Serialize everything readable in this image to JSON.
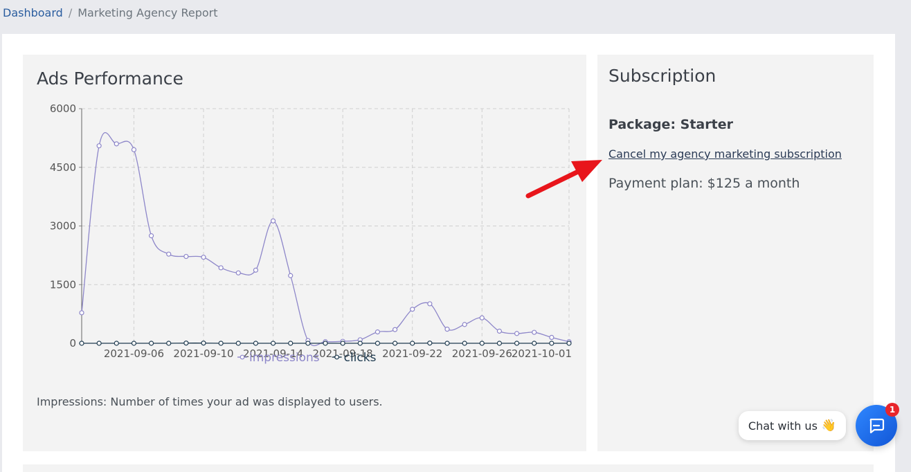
{
  "breadcrumb": {
    "home": "Dashboard",
    "separator": "/",
    "current": "Marketing Agency Report"
  },
  "ads": {
    "title": "Ads Performance",
    "footnote": "Impressions: Number of times your ad was displayed to users."
  },
  "subscription": {
    "title": "Subscription",
    "package": "Package: Starter",
    "cancel_link": "Cancel my agency marketing subscription",
    "payment": "Payment plan: $125 a month"
  },
  "chat": {
    "label": "Chat with us",
    "wave": "👋",
    "badge": "1"
  },
  "colors": {
    "impressions": "#8d86c9",
    "clicks": "#1e3a4f",
    "accent": "#2a5d9f",
    "chat": "#1e6ff0",
    "arrow": "#e8151b"
  },
  "chart_data": {
    "type": "line",
    "x": [
      "2021-09-03",
      "2021-09-04",
      "2021-09-05",
      "2021-09-06",
      "2021-09-07",
      "2021-09-08",
      "2021-09-09",
      "2021-09-10",
      "2021-09-11",
      "2021-09-12",
      "2021-09-13",
      "2021-09-14",
      "2021-09-15",
      "2021-09-16",
      "2021-09-17",
      "2021-09-18",
      "2021-09-19",
      "2021-09-20",
      "2021-09-21",
      "2021-09-22",
      "2021-09-23",
      "2021-09-24",
      "2021-09-25",
      "2021-09-26",
      "2021-09-27",
      "2021-09-28",
      "2021-09-29",
      "2021-09-30",
      "2021-10-01"
    ],
    "series": [
      {
        "name": "impressions",
        "values": [
          780,
          5050,
          5100,
          4950,
          2750,
          2280,
          2220,
          2200,
          1930,
          1800,
          1870,
          3130,
          1730,
          70,
          40,
          50,
          90,
          290,
          350,
          870,
          1010,
          360,
          480,
          650,
          310,
          250,
          280,
          150,
          40
        ]
      },
      {
        "name": "clicks",
        "values": [
          0,
          0,
          0,
          0,
          0,
          0,
          5,
          5,
          0,
          0,
          0,
          0,
          0,
          0,
          0,
          0,
          0,
          0,
          0,
          0,
          5,
          0,
          0,
          0,
          0,
          0,
          0,
          0,
          0
        ]
      }
    ],
    "x_tick_labels": [
      "2021-09-06",
      "2021-09-10",
      "2021-09-14",
      "2021-09-18",
      "2021-09-22",
      "2021-09-26",
      "2021-10-01"
    ],
    "y_ticks": [
      0,
      1500,
      3000,
      4500,
      6000
    ],
    "ylim": [
      0,
      6000
    ],
    "grid": true,
    "legend": "bottom"
  }
}
